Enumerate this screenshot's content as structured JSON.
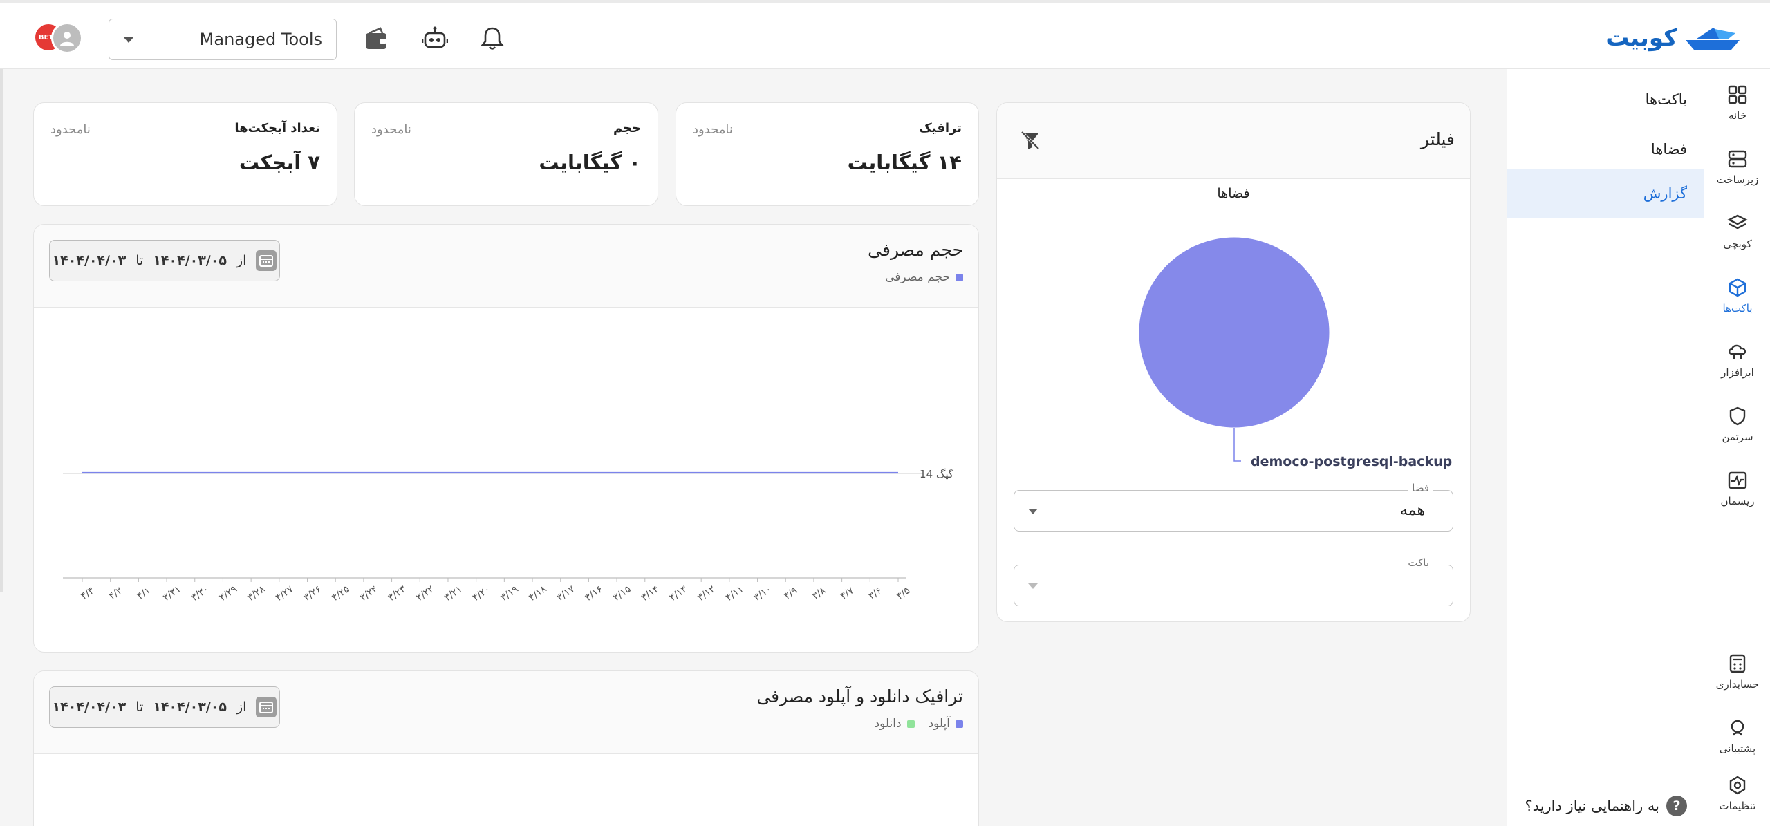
{
  "brand": {
    "name": "کوبیت",
    "color": "#1565c0"
  },
  "header": {
    "org_select": "Managed Tools",
    "icons": [
      "bell-icon",
      "robot-icon",
      "wallet-icon"
    ],
    "avatar_badge": "BETA"
  },
  "rail": {
    "items": [
      {
        "label": "خانه",
        "icon": "grid-icon"
      },
      {
        "label": "زیرساخت",
        "icon": "server-icon"
      },
      {
        "label": "کوبچی",
        "icon": "layers-icon"
      },
      {
        "label": "باکت‌ها",
        "icon": "cube-icon",
        "active": true
      },
      {
        "label": "ابرافزار",
        "icon": "cloud-app-icon"
      },
      {
        "label": "سرتمن",
        "icon": "shield-icon"
      },
      {
        "label": "ریسمان",
        "icon": "pulse-icon"
      }
    ],
    "bottom_items": [
      {
        "label": "حسابداری",
        "icon": "accounting-icon"
      },
      {
        "label": "پشتیبانی",
        "icon": "support-icon"
      },
      {
        "label": "تنظیمات",
        "icon": "settings-icon"
      }
    ]
  },
  "submenu": {
    "items": [
      {
        "label": "باکت‌ها"
      },
      {
        "label": "فضاها"
      },
      {
        "label": "گزارش",
        "active": true
      }
    ],
    "help": "به راهنمایی نیاز دارید؟",
    "help_icon": "?"
  },
  "stats": [
    {
      "title": "ترافیک",
      "limit": "نامحدود",
      "value": "۱۴ گیگابایت"
    },
    {
      "title": "حجم",
      "limit": "نامحدود",
      "value": "۰ گیگابایت"
    },
    {
      "title": "تعداد آبجکت‌ها",
      "limit": "نامحدود",
      "value": "۷ آبجکت"
    }
  ],
  "filter": {
    "title": "فیلتر",
    "pie_title": "فضاها",
    "space_label": "فضا",
    "space_value": "همه",
    "bucket_label": "باکت",
    "bucket_value": ""
  },
  "usage_panel": {
    "title": "حجم مصرفی",
    "legend": [
      {
        "name": "حجم مصرفی",
        "color": "#7b83eb"
      }
    ],
    "date_from_prefix": "از",
    "date_from": "۱۴۰۴/۰۳/۰۵",
    "date_to_prefix": "تا",
    "date_to": "۱۴۰۴/۰۴/۰۳"
  },
  "traffic_panel": {
    "title": "ترافیک دانلود و آپلود مصرفی",
    "legend": [
      {
        "name": "آپلود",
        "color": "#7b83eb"
      },
      {
        "name": "دانلود",
        "color": "#90e39a"
      }
    ],
    "date_from_prefix": "از",
    "date_from": "۱۴۰۴/۰۳/۰۵",
    "date_to_prefix": "تا",
    "date_to": "۱۴۰۴/۰۴/۰۳"
  },
  "chart_data": [
    {
      "type": "pie",
      "title": "فضاها",
      "categories": [
        "democo-postgresql-backup"
      ],
      "values": [
        100
      ],
      "colors": [
        "#8589ea"
      ]
    },
    {
      "type": "line",
      "title": "حجم مصرفی",
      "series": [
        {
          "name": "حجم مصرفی",
          "color": "#7b83eb",
          "values": [
            14,
            14,
            14,
            14,
            14,
            14,
            14,
            14,
            14,
            14,
            14,
            14,
            14,
            14,
            14,
            14,
            14,
            14,
            14,
            14,
            14,
            14,
            14,
            14,
            14,
            14,
            14,
            14,
            14,
            14
          ]
        }
      ],
      "categories": [
        "۳/۵",
        "۳/۶",
        "۳/۷",
        "۳/۸",
        "۳/۹",
        "۳/۱۰",
        "۳/۱۱",
        "۳/۱۲",
        "۳/۱۳",
        "۳/۱۴",
        "۳/۱۵",
        "۳/۱۶",
        "۳/۱۷",
        "۳/۱۸",
        "۳/۱۹",
        "۳/۲۰",
        "۳/۲۱",
        "۳/۲۲",
        "۳/۲۳",
        "۳/۲۴",
        "۳/۲۵",
        "۳/۲۶",
        "۳/۲۷",
        "۳/۲۸",
        "۳/۲۹",
        "۳/۳۰",
        "۳/۳۱",
        "۴/۱",
        "۴/۲",
        "۴/۳"
      ],
      "y_tick_label": "14 گیگ",
      "grid": false
    }
  ]
}
